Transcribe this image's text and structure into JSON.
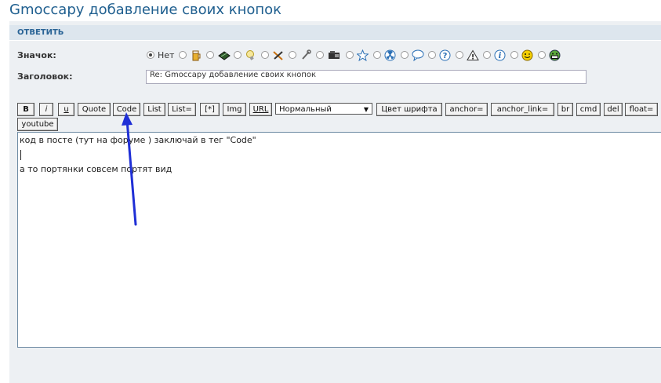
{
  "page": {
    "title": "Gmoccapy добавление своих кнопок"
  },
  "panel": {
    "header": "ОТВЕТИТЬ",
    "icon_label": "Значок:",
    "subject_label": "Заголовок:",
    "subject_value": "Re: Gmoccapy добавление своих кнопок"
  },
  "icons": {
    "none_label": "Нет",
    "items": [
      "beer-icon",
      "chip-icon",
      "bulb-icon",
      "tools-icon",
      "wrench-icon",
      "machine-icon",
      "star-icon",
      "radioactive-icon",
      "speech-bubble-icon",
      "question-icon",
      "warning-icon",
      "info-icon",
      "wink-smiley-icon",
      "grin-smiley-icon"
    ]
  },
  "toolbar": {
    "buttons": [
      "B",
      "i",
      "u",
      "Quote",
      "Code",
      "List",
      "List=",
      "[*]",
      "Img",
      "URL"
    ],
    "font_size_select": "Нормальный",
    "buttons2": [
      "Цвет шрифта",
      "anchor=",
      "anchor_link=",
      "br",
      "cmd",
      "del",
      "float="
    ],
    "row2": [
      "youtube"
    ]
  },
  "editor": {
    "line1": "код  в посте (тут на форуме ) заключай в тег  \"Code\"",
    "line2": "а то портянки совсем портят вид"
  },
  "annotation": {
    "arrow_color": "#1f2fd6"
  }
}
